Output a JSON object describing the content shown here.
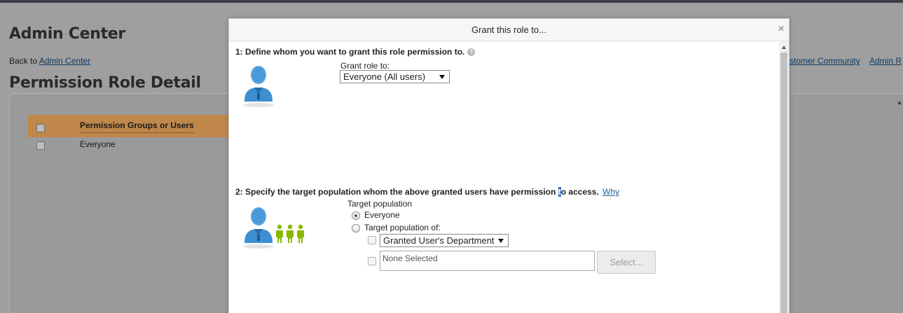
{
  "background": {
    "title": "Admin Center",
    "back_prefix": "Back to ",
    "back_link": "Admin Center",
    "subtitle": "Permission Role Detail",
    "top_links": [
      "stomer Community",
      "Admin R"
    ],
    "table": {
      "header": "Permission Groups or Users",
      "rows": [
        "Everyone"
      ]
    }
  },
  "modal": {
    "title": "Grant this role to...",
    "close_symbol": "×",
    "step1": {
      "heading": "1: Define whom you want to grant this role permission to.",
      "help_symbol": "?",
      "grant_label": "Grant role to:",
      "grant_value": "Everyone (All users)"
    },
    "step2": {
      "heading_before": "2: Specify the target population whom the above granted users have permission ",
      "heading_highlight": "t",
      "heading_after": "o access.",
      "why_link": "Why",
      "target_label": "Target population",
      "option_everyone": "Everyone",
      "option_target_of": "Target population of:",
      "dept_select": "Granted User's Department",
      "none_selected": "None Selected",
      "select_button": "Select..."
    }
  },
  "colors": {
    "table_header": "#c0874a",
    "person_blue": "#3d8fd1",
    "people_green": "#8ab800",
    "overlay_gray": "#9f9f9f"
  },
  "icons": [
    "person-admin-icon",
    "person-group-icon",
    "help-icon",
    "close-icon"
  ]
}
